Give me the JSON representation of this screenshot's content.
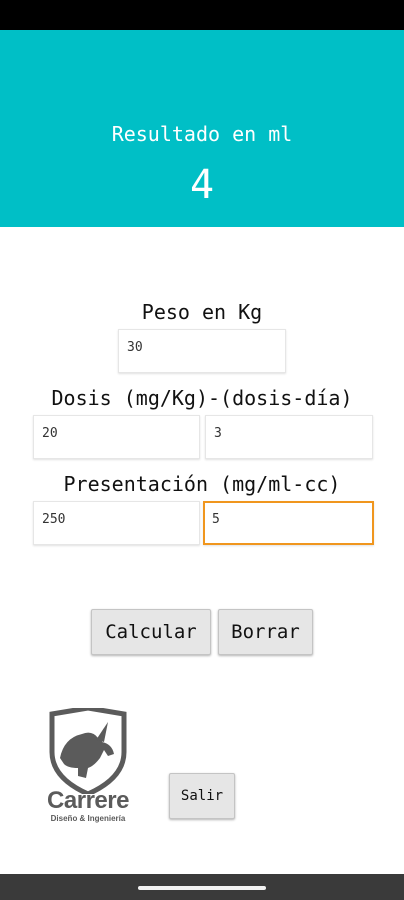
{
  "result": {
    "label": "Resultado en ml",
    "value": "4"
  },
  "peso": {
    "label": "Peso en Kg",
    "value": "30"
  },
  "dosis": {
    "label": "Dosis (mg/Kg)-(dosis-día)",
    "mg_kg_value": "20",
    "dosis_dia_value": "3"
  },
  "presentacion": {
    "label": "Presentación (mg/ml-cc)",
    "mg_value": "250",
    "ml_value": "5"
  },
  "buttons": {
    "calcular": "Calcular",
    "borrar": "Borrar",
    "salir": "Salir"
  },
  "logo": {
    "name": "Carrere",
    "tagline": "Diseño & Ingeniería",
    "icon": "rhino-shield-icon"
  },
  "colors": {
    "accent": "#00bfc6",
    "focus": "#f0961e"
  }
}
